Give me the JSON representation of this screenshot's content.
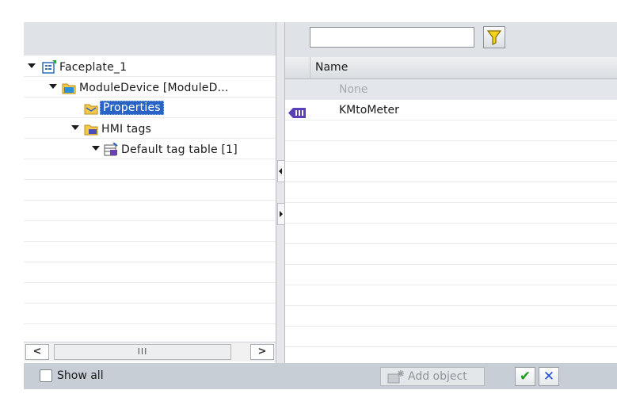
{
  "tree": {
    "items": [
      {
        "label": "Faceplate_1",
        "icon": "faceplate-icon",
        "expanded": true
      },
      {
        "label": "ModuleDevice [ModuleD...",
        "icon": "folder-icon",
        "expanded": true
      },
      {
        "label": "Properties",
        "icon": "properties-folder-icon",
        "selected": true
      },
      {
        "label": "HMI tags",
        "icon": "hmi-tags-folder-icon",
        "expanded": true
      },
      {
        "label": "Default tag table [1]",
        "icon": "tag-table-icon",
        "expanded": true
      }
    ],
    "scroll_thumb_grip": "III"
  },
  "list": {
    "search_value": "",
    "column_header": "Name",
    "rows": [
      {
        "label": "None",
        "disabled": true
      },
      {
        "label": "KMtoMeter",
        "icon": "tag-icon"
      }
    ]
  },
  "footer": {
    "show_all_label": "Show all",
    "show_all_checked": false,
    "add_object_label": "Add object"
  },
  "colors": {
    "selection": "#2a63c7",
    "ok": "#1e9c1e",
    "cancel": "#1f4fd6",
    "filter_funnel": "#f2d21b"
  }
}
